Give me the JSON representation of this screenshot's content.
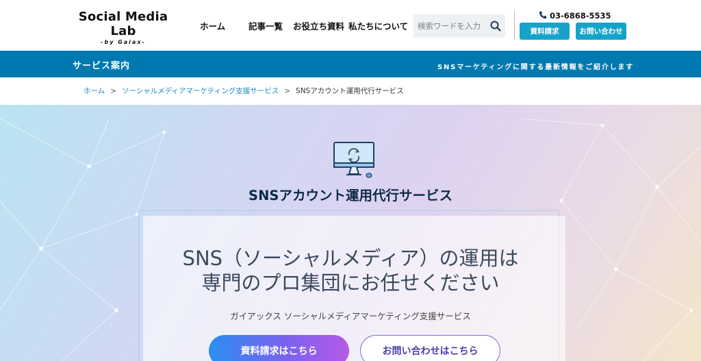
{
  "header": {
    "logo_main": "Social Media Lab",
    "logo_sub": "-by Gaiax-",
    "nav": [
      "ホーム",
      "記事一覧",
      "お役立ち資料",
      "私たちについて"
    ],
    "search_placeholder": "検索ワードを入力",
    "phone": "03-6868-5535",
    "btn_docs": "資料請求",
    "btn_contact": "お問い合わせ"
  },
  "bluebar": {
    "title": "サービス案内",
    "tagline": "SNSマーケティングに関する最新情報をご紹介します"
  },
  "breadcrumb": {
    "home": "ホーム",
    "sep": ">",
    "parent": "ソーシャルメディアマーケティング支援サービス",
    "current": "SNSアカウント運用代行サービス"
  },
  "hero": {
    "service_title": "SNSアカウント運用代行サービス",
    "headline_line1": "SNS（ソーシャルメディア）の運用は",
    "headline_line2": "専門のプロ集団にお任せください",
    "subline": "ガイアックス ソーシャルメディアマーケティング支援サービス",
    "cta_primary": "資料請求はこちら",
    "cta_secondary": "お問い合わせはこちら"
  },
  "colors": {
    "brand_blue": "#0079b0",
    "button_teal": "#16a3c9",
    "cta_gradient_start": "#2b8ef0",
    "cta_gradient_end": "#b45be6",
    "cta_outline": "#7a6cd9"
  },
  "icons": [
    "search-icon",
    "phone-icon",
    "monitor-sync-icon"
  ]
}
